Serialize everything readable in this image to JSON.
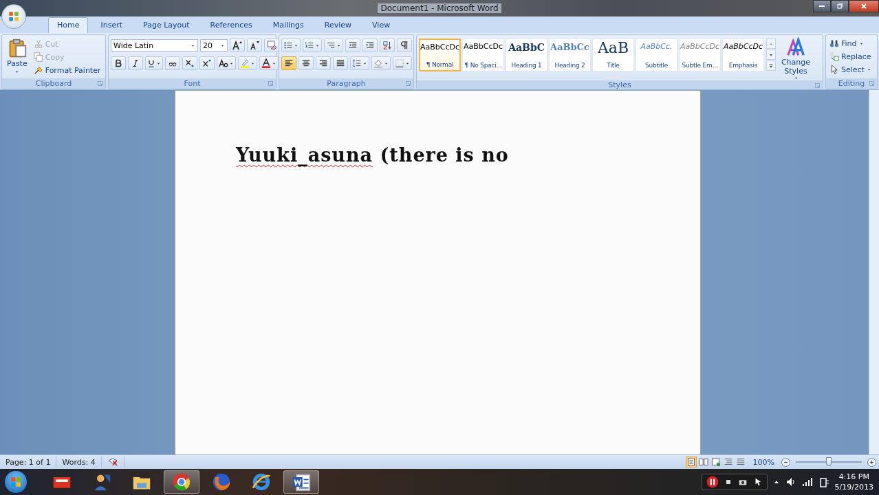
{
  "window": {
    "title": "Document1 - Microsoft Word"
  },
  "tabs": [
    {
      "label": "Home",
      "selected": true
    },
    {
      "label": "Insert",
      "selected": false
    },
    {
      "label": "Page Layout",
      "selected": false
    },
    {
      "label": "References",
      "selected": false
    },
    {
      "label": "Mailings",
      "selected": false
    },
    {
      "label": "Review",
      "selected": false
    },
    {
      "label": "View",
      "selected": false
    }
  ],
  "clipboard": {
    "label": "Clipboard",
    "paste": "Paste",
    "actions": [
      {
        "label": "Cut",
        "disabled": true,
        "kind": "cut"
      },
      {
        "label": "Copy",
        "disabled": true,
        "kind": "copy"
      },
      {
        "label": "Format Painter",
        "disabled": false,
        "kind": "painter"
      }
    ]
  },
  "font": {
    "label": "Font",
    "font_name": "Wide Latin",
    "font_size": "20"
  },
  "paragraph": {
    "label": "Paragraph",
    "alignments": [
      {
        "kind": "left",
        "selected": true
      },
      {
        "kind": "center",
        "selected": false
      },
      {
        "kind": "right",
        "selected": false
      },
      {
        "kind": "justify",
        "selected": false
      }
    ]
  },
  "styles": {
    "label": "Styles",
    "change_styles": "Change Styles",
    "items": [
      {
        "preview": "AaBbCcDc",
        "name": "¶ Normal",
        "kind": "normal",
        "selected": true
      },
      {
        "preview": "AaBbCcDc",
        "name": "¶ No Spaci...",
        "kind": "normal",
        "selected": false
      },
      {
        "preview": "AaBbC",
        "name": "Heading 1",
        "kind": "heading1",
        "selected": false
      },
      {
        "preview": "AaBbCc",
        "name": "Heading 2",
        "kind": "heading2",
        "selected": false
      },
      {
        "preview": "AaB",
        "name": "Title",
        "kind": "title",
        "selected": false
      },
      {
        "preview": "AaBbCc.",
        "name": "Subtitle",
        "kind": "subtitle",
        "selected": false
      },
      {
        "preview": "AaBbCcDc",
        "name": "Subtle Em...",
        "kind": "subtle",
        "selected": false
      },
      {
        "preview": "AaBbCcDc",
        "name": "Emphasis",
        "kind": "emphasis",
        "selected": false
      }
    ]
  },
  "editing": {
    "label": "Editing",
    "find": "Find",
    "replace": "Replace",
    "select": "Select"
  },
  "document": {
    "runs": [
      {
        "text": "Yuuki_asuna",
        "misspelled": true
      },
      {
        "text": " (there is no",
        "misspelled": false
      }
    ]
  },
  "status_bar": {
    "page": "Page: 1 of 1",
    "words": "Words: 4",
    "zoom": "100%",
    "zoom_slider": {
      "level": 0.5
    },
    "views": [
      {
        "kind": "print",
        "selected": true
      },
      {
        "kind": "reading",
        "selected": false
      },
      {
        "kind": "web",
        "selected": false
      },
      {
        "kind": "outline",
        "selected": false
      },
      {
        "kind": "draft",
        "selected": false
      }
    ]
  },
  "taskbar": {
    "apps": [
      {
        "kind": "smart",
        "active": false
      },
      {
        "kind": "person",
        "active": false
      },
      {
        "kind": "folder",
        "active": false
      },
      {
        "kind": "chrome",
        "active": true
      },
      {
        "kind": "firefox",
        "active": false
      },
      {
        "kind": "ie",
        "active": false
      },
      {
        "kind": "word",
        "active": true
      }
    ],
    "time": "4:16 PM",
    "date": "5/19/2013"
  }
}
